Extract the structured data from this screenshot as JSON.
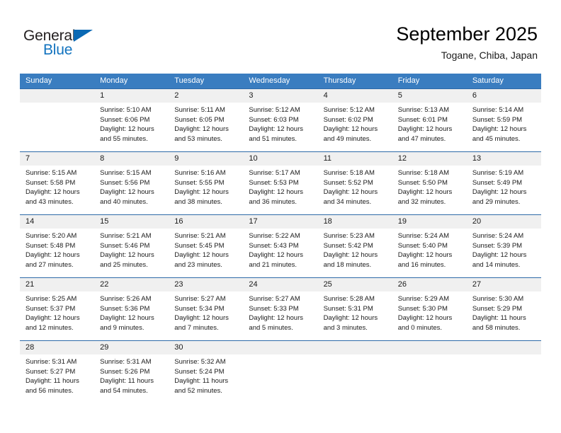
{
  "brand": {
    "name_top": "General",
    "name_bottom": "Blue",
    "triangle_color": "#0a69b4",
    "blue_color": "#1273bf"
  },
  "header": {
    "title": "September 2025",
    "subtitle": "Togane, Chiba, Japan"
  },
  "theme": {
    "header_bg": "#3a7dc0",
    "header_text": "#ffffff",
    "number_band_bg": "#f0f0f0",
    "week_divider": "#2e6aa8",
    "cell_text": "#1a1a1a"
  },
  "weekdays": [
    "Sunday",
    "Monday",
    "Tuesday",
    "Wednesday",
    "Thursday",
    "Friday",
    "Saturday"
  ],
  "weeks": [
    {
      "numbers": [
        "",
        "1",
        "2",
        "3",
        "4",
        "5",
        "6"
      ],
      "days": [
        {
          "sunrise": "",
          "sunset": "",
          "daylight_1": "",
          "daylight_2": ""
        },
        {
          "sunrise": "Sunrise: 5:10 AM",
          "sunset": "Sunset: 6:06 PM",
          "daylight_1": "Daylight: 12 hours",
          "daylight_2": "and 55 minutes."
        },
        {
          "sunrise": "Sunrise: 5:11 AM",
          "sunset": "Sunset: 6:05 PM",
          "daylight_1": "Daylight: 12 hours",
          "daylight_2": "and 53 minutes."
        },
        {
          "sunrise": "Sunrise: 5:12 AM",
          "sunset": "Sunset: 6:03 PM",
          "daylight_1": "Daylight: 12 hours",
          "daylight_2": "and 51 minutes."
        },
        {
          "sunrise": "Sunrise: 5:12 AM",
          "sunset": "Sunset: 6:02 PM",
          "daylight_1": "Daylight: 12 hours",
          "daylight_2": "and 49 minutes."
        },
        {
          "sunrise": "Sunrise: 5:13 AM",
          "sunset": "Sunset: 6:01 PM",
          "daylight_1": "Daylight: 12 hours",
          "daylight_2": "and 47 minutes."
        },
        {
          "sunrise": "Sunrise: 5:14 AM",
          "sunset": "Sunset: 5:59 PM",
          "daylight_1": "Daylight: 12 hours",
          "daylight_2": "and 45 minutes."
        }
      ]
    },
    {
      "numbers": [
        "7",
        "8",
        "9",
        "10",
        "11",
        "12",
        "13"
      ],
      "days": [
        {
          "sunrise": "Sunrise: 5:15 AM",
          "sunset": "Sunset: 5:58 PM",
          "daylight_1": "Daylight: 12 hours",
          "daylight_2": "and 43 minutes."
        },
        {
          "sunrise": "Sunrise: 5:15 AM",
          "sunset": "Sunset: 5:56 PM",
          "daylight_1": "Daylight: 12 hours",
          "daylight_2": "and 40 minutes."
        },
        {
          "sunrise": "Sunrise: 5:16 AM",
          "sunset": "Sunset: 5:55 PM",
          "daylight_1": "Daylight: 12 hours",
          "daylight_2": "and 38 minutes."
        },
        {
          "sunrise": "Sunrise: 5:17 AM",
          "sunset": "Sunset: 5:53 PM",
          "daylight_1": "Daylight: 12 hours",
          "daylight_2": "and 36 minutes."
        },
        {
          "sunrise": "Sunrise: 5:18 AM",
          "sunset": "Sunset: 5:52 PM",
          "daylight_1": "Daylight: 12 hours",
          "daylight_2": "and 34 minutes."
        },
        {
          "sunrise": "Sunrise: 5:18 AM",
          "sunset": "Sunset: 5:50 PM",
          "daylight_1": "Daylight: 12 hours",
          "daylight_2": "and 32 minutes."
        },
        {
          "sunrise": "Sunrise: 5:19 AM",
          "sunset": "Sunset: 5:49 PM",
          "daylight_1": "Daylight: 12 hours",
          "daylight_2": "and 29 minutes."
        }
      ]
    },
    {
      "numbers": [
        "14",
        "15",
        "16",
        "17",
        "18",
        "19",
        "20"
      ],
      "days": [
        {
          "sunrise": "Sunrise: 5:20 AM",
          "sunset": "Sunset: 5:48 PM",
          "daylight_1": "Daylight: 12 hours",
          "daylight_2": "and 27 minutes."
        },
        {
          "sunrise": "Sunrise: 5:21 AM",
          "sunset": "Sunset: 5:46 PM",
          "daylight_1": "Daylight: 12 hours",
          "daylight_2": "and 25 minutes."
        },
        {
          "sunrise": "Sunrise: 5:21 AM",
          "sunset": "Sunset: 5:45 PM",
          "daylight_1": "Daylight: 12 hours",
          "daylight_2": "and 23 minutes."
        },
        {
          "sunrise": "Sunrise: 5:22 AM",
          "sunset": "Sunset: 5:43 PM",
          "daylight_1": "Daylight: 12 hours",
          "daylight_2": "and 21 minutes."
        },
        {
          "sunrise": "Sunrise: 5:23 AM",
          "sunset": "Sunset: 5:42 PM",
          "daylight_1": "Daylight: 12 hours",
          "daylight_2": "and 18 minutes."
        },
        {
          "sunrise": "Sunrise: 5:24 AM",
          "sunset": "Sunset: 5:40 PM",
          "daylight_1": "Daylight: 12 hours",
          "daylight_2": "and 16 minutes."
        },
        {
          "sunrise": "Sunrise: 5:24 AM",
          "sunset": "Sunset: 5:39 PM",
          "daylight_1": "Daylight: 12 hours",
          "daylight_2": "and 14 minutes."
        }
      ]
    },
    {
      "numbers": [
        "21",
        "22",
        "23",
        "24",
        "25",
        "26",
        "27"
      ],
      "days": [
        {
          "sunrise": "Sunrise: 5:25 AM",
          "sunset": "Sunset: 5:37 PM",
          "daylight_1": "Daylight: 12 hours",
          "daylight_2": "and 12 minutes."
        },
        {
          "sunrise": "Sunrise: 5:26 AM",
          "sunset": "Sunset: 5:36 PM",
          "daylight_1": "Daylight: 12 hours",
          "daylight_2": "and 9 minutes."
        },
        {
          "sunrise": "Sunrise: 5:27 AM",
          "sunset": "Sunset: 5:34 PM",
          "daylight_1": "Daylight: 12 hours",
          "daylight_2": "and 7 minutes."
        },
        {
          "sunrise": "Sunrise: 5:27 AM",
          "sunset": "Sunset: 5:33 PM",
          "daylight_1": "Daylight: 12 hours",
          "daylight_2": "and 5 minutes."
        },
        {
          "sunrise": "Sunrise: 5:28 AM",
          "sunset": "Sunset: 5:31 PM",
          "daylight_1": "Daylight: 12 hours",
          "daylight_2": "and 3 minutes."
        },
        {
          "sunrise": "Sunrise: 5:29 AM",
          "sunset": "Sunset: 5:30 PM",
          "daylight_1": "Daylight: 12 hours",
          "daylight_2": "and 0 minutes."
        },
        {
          "sunrise": "Sunrise: 5:30 AM",
          "sunset": "Sunset: 5:29 PM",
          "daylight_1": "Daylight: 11 hours",
          "daylight_2": "and 58 minutes."
        }
      ]
    },
    {
      "numbers": [
        "28",
        "29",
        "30",
        "",
        "",
        "",
        ""
      ],
      "days": [
        {
          "sunrise": "Sunrise: 5:31 AM",
          "sunset": "Sunset: 5:27 PM",
          "daylight_1": "Daylight: 11 hours",
          "daylight_2": "and 56 minutes."
        },
        {
          "sunrise": "Sunrise: 5:31 AM",
          "sunset": "Sunset: 5:26 PM",
          "daylight_1": "Daylight: 11 hours",
          "daylight_2": "and 54 minutes."
        },
        {
          "sunrise": "Sunrise: 5:32 AM",
          "sunset": "Sunset: 5:24 PM",
          "daylight_1": "Daylight: 11 hours",
          "daylight_2": "and 52 minutes."
        },
        {
          "sunrise": "",
          "sunset": "",
          "daylight_1": "",
          "daylight_2": ""
        },
        {
          "sunrise": "",
          "sunset": "",
          "daylight_1": "",
          "daylight_2": ""
        },
        {
          "sunrise": "",
          "sunset": "",
          "daylight_1": "",
          "daylight_2": ""
        },
        {
          "sunrise": "",
          "sunset": "",
          "daylight_1": "",
          "daylight_2": ""
        }
      ]
    }
  ]
}
